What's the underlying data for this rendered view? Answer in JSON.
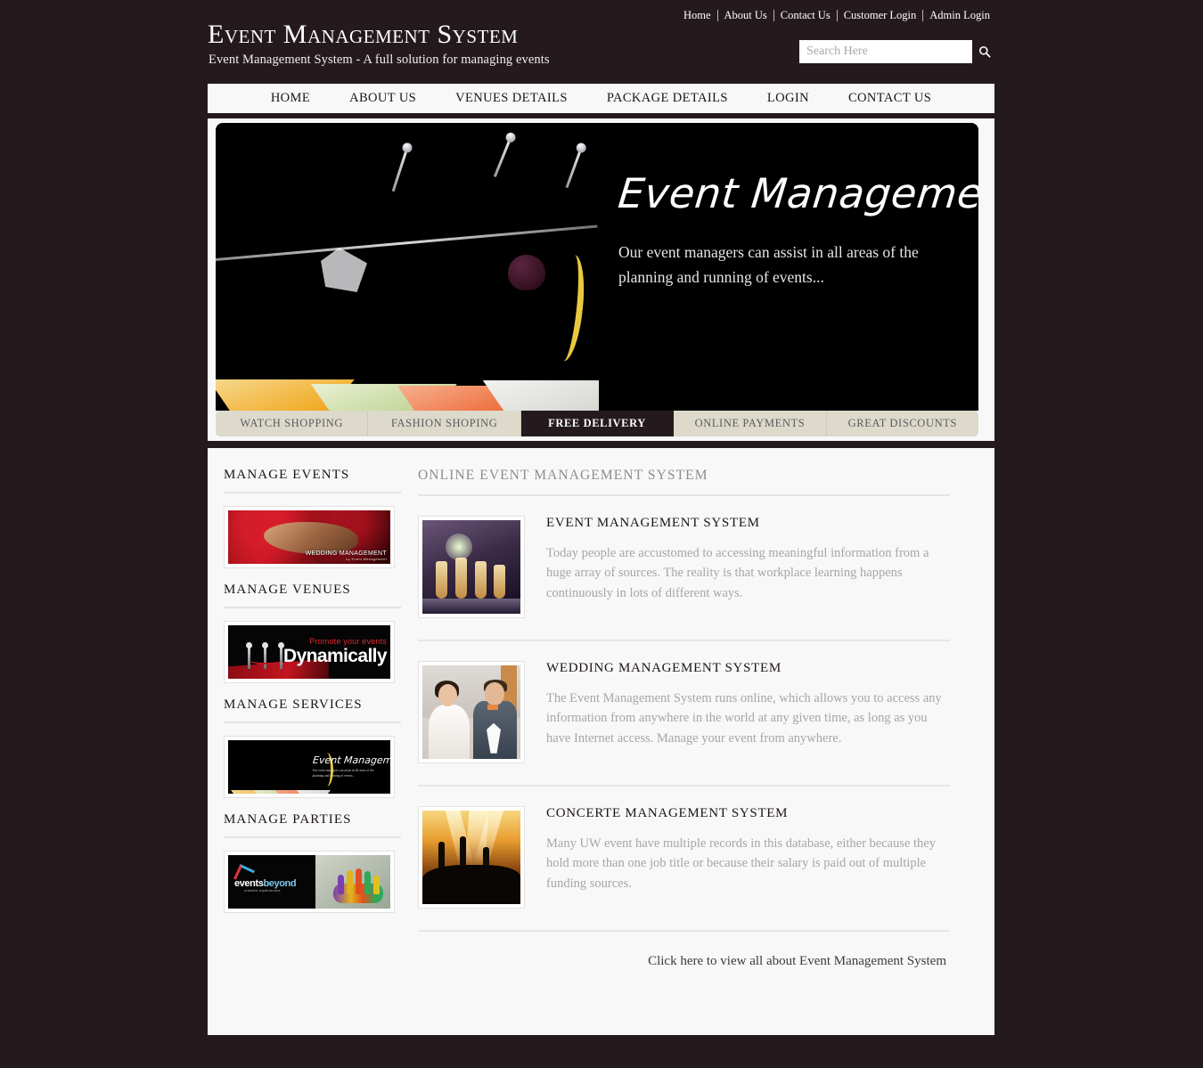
{
  "header": {
    "title": "Event Management System",
    "tagline": "Event Management System - A full solution for managing events",
    "top_links": [
      "Home",
      "About Us",
      "Contact Us",
      "Customer Login",
      "Admin Login"
    ],
    "search": {
      "placeholder": "Search Here",
      "value": "",
      "button_icon": "search-icon"
    }
  },
  "nav": {
    "items": [
      "HOME",
      "ABOUT US",
      "VENUES DETAILS",
      "PACKAGE DETAILS",
      "LOGIN",
      "CONTACT US"
    ]
  },
  "banner": {
    "title": "Event Management",
    "subtitle": "Our event managers can assist in all areas of the planning and running of events...",
    "image_alt": "cocktail-glasses-photo"
  },
  "tabs": [
    {
      "label": "WATCH SHOPPING",
      "active": false
    },
    {
      "label": "FASHION SHOPING",
      "active": false
    },
    {
      "label": "FREE DELIVERY",
      "active": true
    },
    {
      "label": "ONLINE PAYMENTS",
      "active": false
    },
    {
      "label": "GREAT DISCOUNTS",
      "active": false
    }
  ],
  "sidebar": {
    "sections": [
      {
        "heading": "MANAGE EVENTS",
        "thumb_alt": "wedding-management-banner"
      },
      {
        "heading": "MANAGE VENUES",
        "thumb_alt": "promote-your-events-dynamically-banner"
      },
      {
        "heading": "MANAGE SERVICES",
        "thumb_alt": "event-management-cocktail-banner"
      },
      {
        "heading": "MANAGE PARTIES",
        "thumb_alt": "events-beyond-painted-hands-banner"
      }
    ],
    "thumb_texts": {
      "wedding_caption": "WEDDING MANAGEMENT",
      "wedding_sub": "by Event Management",
      "dynamic_line1": "Promote your events",
      "dynamic_line2": "Dynamically",
      "event_title": "Event Management",
      "event_sub": "Our event managers can assist in all areas of the planning and running of events...",
      "parties_brand": "events",
      "parties_brand2": "beyond",
      "parties_sub": "creative experiences"
    }
  },
  "main": {
    "heading": "ONLINE EVENT MANAGEMENT SYSTEM",
    "articles": [
      {
        "title": "EVENT MANAGEMENT SYSTEM",
        "text": "Today people are accustomed to accessing meaningful information from a huge array of sources. The reality is that workplace learning happens continuously in lots of different ways.",
        "thumb_alt": "champagne-flutes-photo"
      },
      {
        "title": "WEDDING MANAGEMENT SYSTEM",
        "text": "The Event Management System runs online, which allows you to access any information from anywhere in the world at any given time, as long as you have Internet access. Manage your event from anywhere.",
        "thumb_alt": "wedding-couple-photo"
      },
      {
        "title": "CONCERTE MANAGEMENT SYSTEM",
        "text": "Many UW event have multiple records in this database, either because they hold more than one job title or because their salary is paid out of multiple funding sources.",
        "thumb_alt": "concert-crowd-photo"
      }
    ],
    "view_all_link": "Click here to view all about Event Management System"
  },
  "colors": {
    "page_background": "#241a1e",
    "panel_background": "#f8f8f8",
    "tab_inactive": "#ddd9cb",
    "tab_active": "#241a1e",
    "body_text": "#a6a6a6",
    "heading_text": "#1c1418"
  }
}
